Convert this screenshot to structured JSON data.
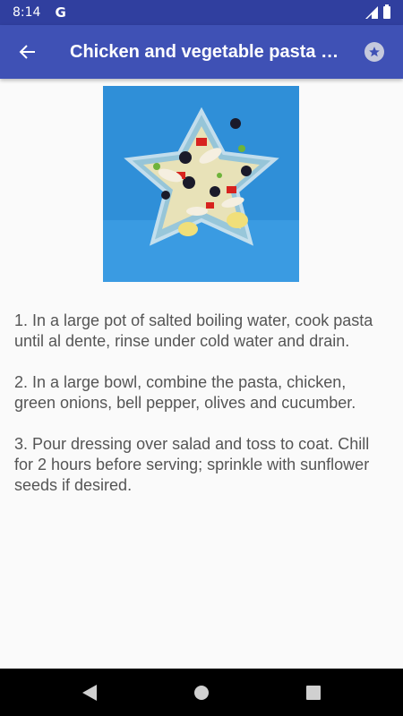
{
  "status_bar": {
    "time": "8:14",
    "g_label": "G"
  },
  "app_bar": {
    "title": "Chicken and vegetable pasta salad",
    "back_icon": "arrow-left-icon",
    "favorite_icon": "star-icon"
  },
  "recipe": {
    "image_icon": "pasta-salad-photo",
    "steps": [
      "1. In a large pot of salted boiling water, cook pasta until al dente, rinse under cold water and drain.",
      "2. In a large bowl, combine the pasta, chicken, green onions, bell pepper, olives and cucumber.",
      "3. Pour dressing over salad and toss to coat. Chill for 2 hours before serving; sprinkle with sunflower seeds if desired."
    ]
  },
  "colors": {
    "status_bar": "#303f9f",
    "app_bar": "#3f51b5",
    "text": "#555555",
    "image_bg": "#2f8fd8"
  }
}
